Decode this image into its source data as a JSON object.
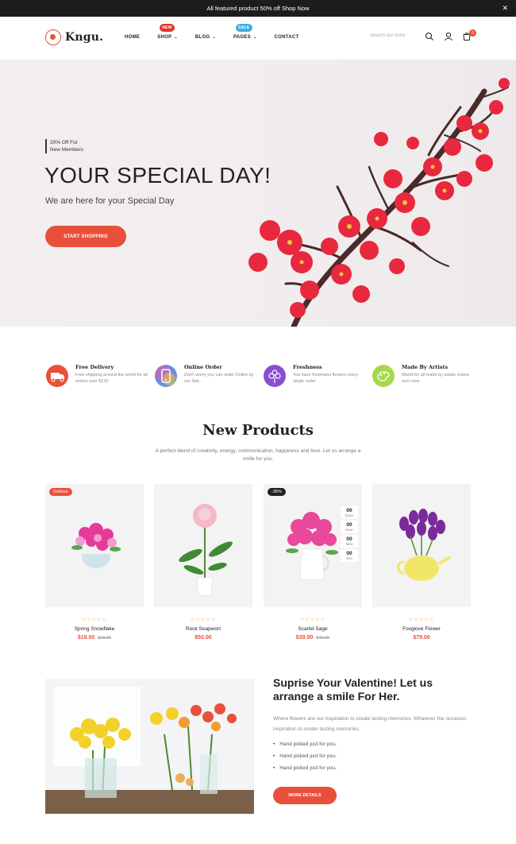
{
  "announcement": {
    "text": "All featured product 50% off Shop Now",
    "close": "✕"
  },
  "header": {
    "logo": "Kngu.",
    "nav": [
      {
        "label": "HOME",
        "has_dropdown": false,
        "badge": ""
      },
      {
        "label": "SHOP",
        "has_dropdown": true,
        "badge": "NEW"
      },
      {
        "label": "BLOG",
        "has_dropdown": true,
        "badge": ""
      },
      {
        "label": "PAGES",
        "has_dropdown": true,
        "badge": "SALE"
      },
      {
        "label": "CONTACT",
        "has_dropdown": false,
        "badge": ""
      }
    ],
    "search_placeholder": "Search our store",
    "cart_count": "0",
    "icons": [
      "search-icon",
      "user-icon",
      "cart-icon"
    ]
  },
  "hero": {
    "tag_line1": "20% Off For",
    "tag_line2": "New Members",
    "title": "YOUR SPECIAL DAY!",
    "subtitle": "We are here for your Special Day",
    "button": "START SHOPPING"
  },
  "features": [
    {
      "title": "Free Delivery",
      "desc": "Free shipping around the world for all orders over $120",
      "icon": "truck-icon",
      "color": "#e8503a"
    },
    {
      "title": "Online Order",
      "desc": "Don't worry you can order Online by our Site",
      "icon": "phone-icon",
      "color": "#6a8fe0"
    },
    {
      "title": "Freshness",
      "desc": "You have freshness flowers every single order",
      "icon": "flower-icon",
      "color": "#8a4fd0"
    },
    {
      "title": "Made By Artists",
      "desc": "World for all made by artists orders over now",
      "icon": "palette-icon",
      "color": "#a6d84a"
    }
  ],
  "new_products": {
    "title": "New Products",
    "desc": "A perfect blend of creativity, energy, communication, happiness and love. Let us arrange a smile for you."
  },
  "products": [
    {
      "name": "Spring Snowflake",
      "price": "$19.00",
      "old_price": "$29.00",
      "badge": "Soldout",
      "stars": "☆☆☆☆☆"
    },
    {
      "name": "Rock Soapwort",
      "price": "$50.00",
      "old_price": "",
      "badge": "",
      "stars": "☆☆☆☆☆"
    },
    {
      "name": "Scarlet Sage",
      "price": "$39.00",
      "old_price": "$49.00",
      "badge": "-35%",
      "stars": "☆☆☆☆☆",
      "countdown": [
        {
          "num": "00",
          "label": "Days"
        },
        {
          "num": "00",
          "label": "Hour"
        },
        {
          "num": "00",
          "label": "Mint"
        },
        {
          "num": "00",
          "label": "Sec"
        }
      ]
    },
    {
      "name": "Foxglove Flower",
      "price": "$79.00",
      "old_price": "",
      "badge": "",
      "stars": "☆☆☆☆☆"
    }
  ],
  "valentine": {
    "title": "Suprise Your Valentine! Let us arrange a smile For Her.",
    "desc": "Where flowers are our inspiration to create lasting memories. Whatever the occasion inspiration to create lasting memories.",
    "list": [
      "Hand picked just for you.",
      "Hand picked just for you.",
      "Hand picked just for you."
    ],
    "button": "MORE DETAILS"
  },
  "colors": {
    "accent": "#e8503a",
    "dark": "#1c1c1c"
  }
}
